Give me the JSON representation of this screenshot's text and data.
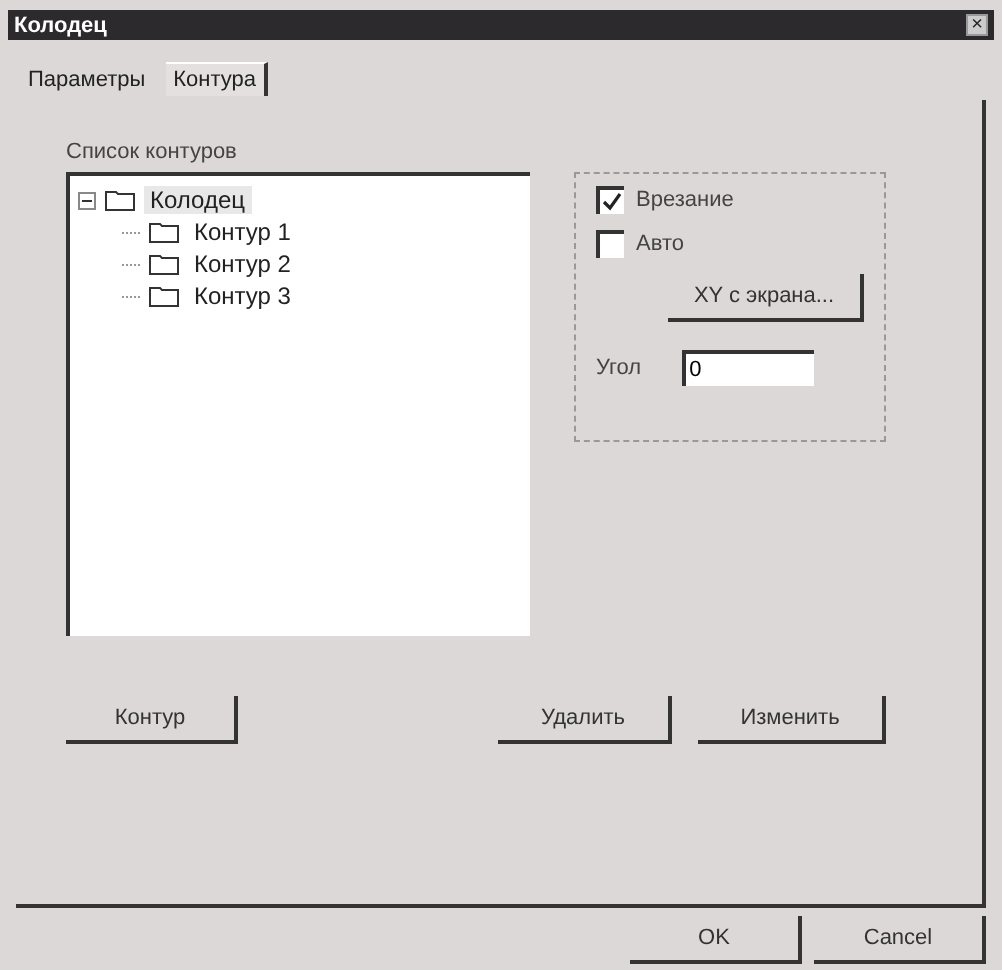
{
  "window": {
    "title": "Колодец",
    "close": "×"
  },
  "tabs": [
    {
      "label": "Параметры",
      "selected": false
    },
    {
      "label": "Контура",
      "selected": true
    }
  ],
  "contour_list": {
    "label": "Список контуров",
    "tree": [
      {
        "label": "Колодец",
        "expanded": true,
        "selected": true,
        "children": [
          {
            "label": "Контур 1",
            "selected": false
          },
          {
            "label": "Контур 2",
            "selected": false
          },
          {
            "label": "Контур 3",
            "selected": false
          }
        ]
      }
    ]
  },
  "options": {
    "checkboxes": [
      {
        "label": "Врезание",
        "checked": true
      },
      {
        "label": "Авто",
        "checked": false
      }
    ],
    "xy_button": "XY с экрана...",
    "angle": {
      "label": "Угол",
      "value": "0"
    }
  },
  "actions": [
    "Контур",
    "Удалить",
    "Изменить"
  ],
  "buttons": [
    "OK",
    "Cancel"
  ]
}
